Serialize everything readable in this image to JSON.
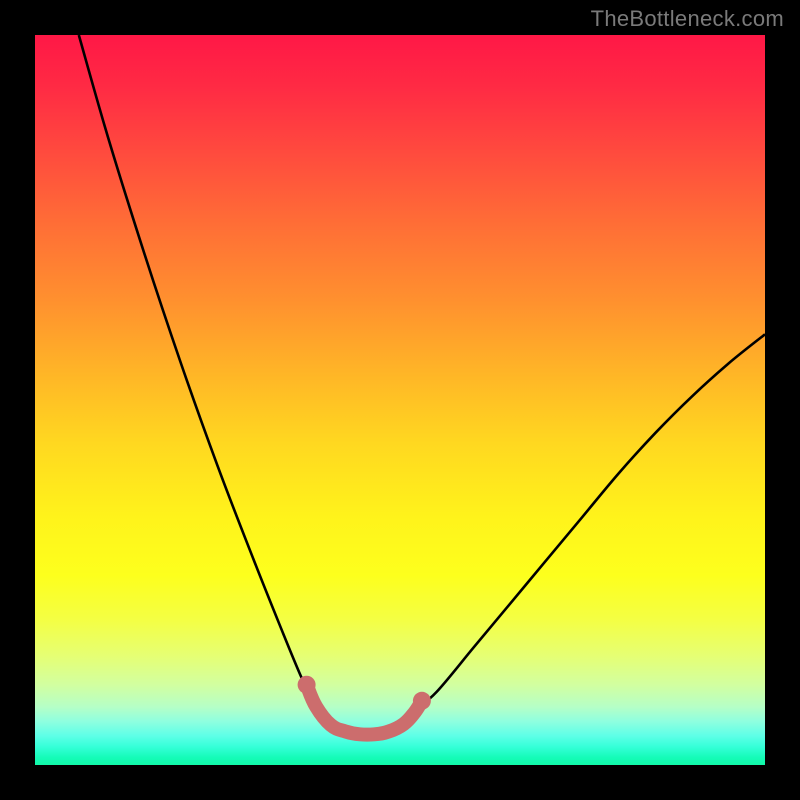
{
  "watermark": "TheBottleneck.com",
  "colors": {
    "frame": "#000000",
    "curve": "#000000",
    "marker": "#cc6d6d",
    "gradient_top": "#ff1846",
    "gradient_bottom": "#12f8a8"
  },
  "chart_data": {
    "type": "line",
    "title": "",
    "xlabel": "",
    "ylabel": "",
    "xlim": [
      0,
      100
    ],
    "ylim": [
      0,
      100
    ],
    "grid": false,
    "legend": false,
    "series": [
      {
        "name": "bottleneck-curve",
        "x": [
          6,
          10,
          15,
          20,
          25,
          30,
          34,
          36.5,
          38,
          40,
          42,
          44,
          46,
          48,
          50,
          52,
          55,
          60,
          65,
          70,
          75,
          80,
          85,
          90,
          95,
          100
        ],
        "y": [
          100,
          86,
          70,
          55,
          41,
          28,
          18,
          12,
          9,
          6,
          4.5,
          4,
          4,
          4.5,
          5.5,
          7.5,
          10,
          16,
          22,
          28,
          34,
          40,
          45.5,
          50.5,
          55,
          59
        ]
      }
    ],
    "annotations": [
      {
        "name": "min-region-markers",
        "type": "scatter",
        "x": [
          37.2,
          38.5,
          40.5,
          42.5,
          44.5,
          46.5,
          48.5,
          50.5,
          52,
          53
        ],
        "y": [
          11,
          8,
          5.5,
          4.6,
          4.2,
          4.2,
          4.6,
          5.6,
          7.2,
          8.8
        ]
      }
    ]
  }
}
